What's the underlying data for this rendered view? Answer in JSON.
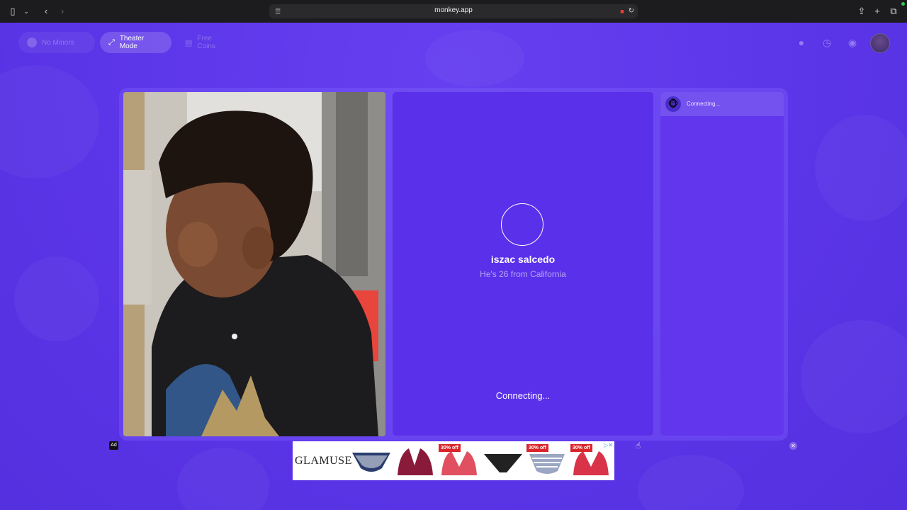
{
  "browser": {
    "url": "monkey.app",
    "icons": [
      "sidebar-toggle-icon",
      "chevron-down-icon",
      "back-icon",
      "forward-icon",
      "site-settings-icon",
      "camera-recording-icon",
      "reload-icon",
      "share-icon",
      "new-tab-icon",
      "tab-overview-icon"
    ]
  },
  "toolbar": {
    "no_minors_label": "No Minors",
    "theater_mode_label": "Theater Mode",
    "free_coins_label": "Free Coins",
    "right_icons": [
      "badge-icon",
      "history-icon",
      "eye-icon",
      "profile-avatar"
    ]
  },
  "peer": {
    "name": "iszac salcedo",
    "subtitle": "He's 26 from California",
    "status": "Connecting..."
  },
  "chat": {
    "status": "Connecting..."
  },
  "ad": {
    "badge": "Ad",
    "brand": "GLAMUSE",
    "items": [
      {
        "tag": ""
      },
      {
        "tag": ""
      },
      {
        "tag": "30% off"
      },
      {
        "tag": ""
      },
      {
        "tag": "30% off"
      },
      {
        "tag": "30% off"
      }
    ],
    "choices_glyph": "▷✕",
    "close_glyph": "✕"
  },
  "colors": {
    "background": "#5b35e8",
    "panel": "#5a30ea",
    "ad_tag": "#d8262b"
  }
}
